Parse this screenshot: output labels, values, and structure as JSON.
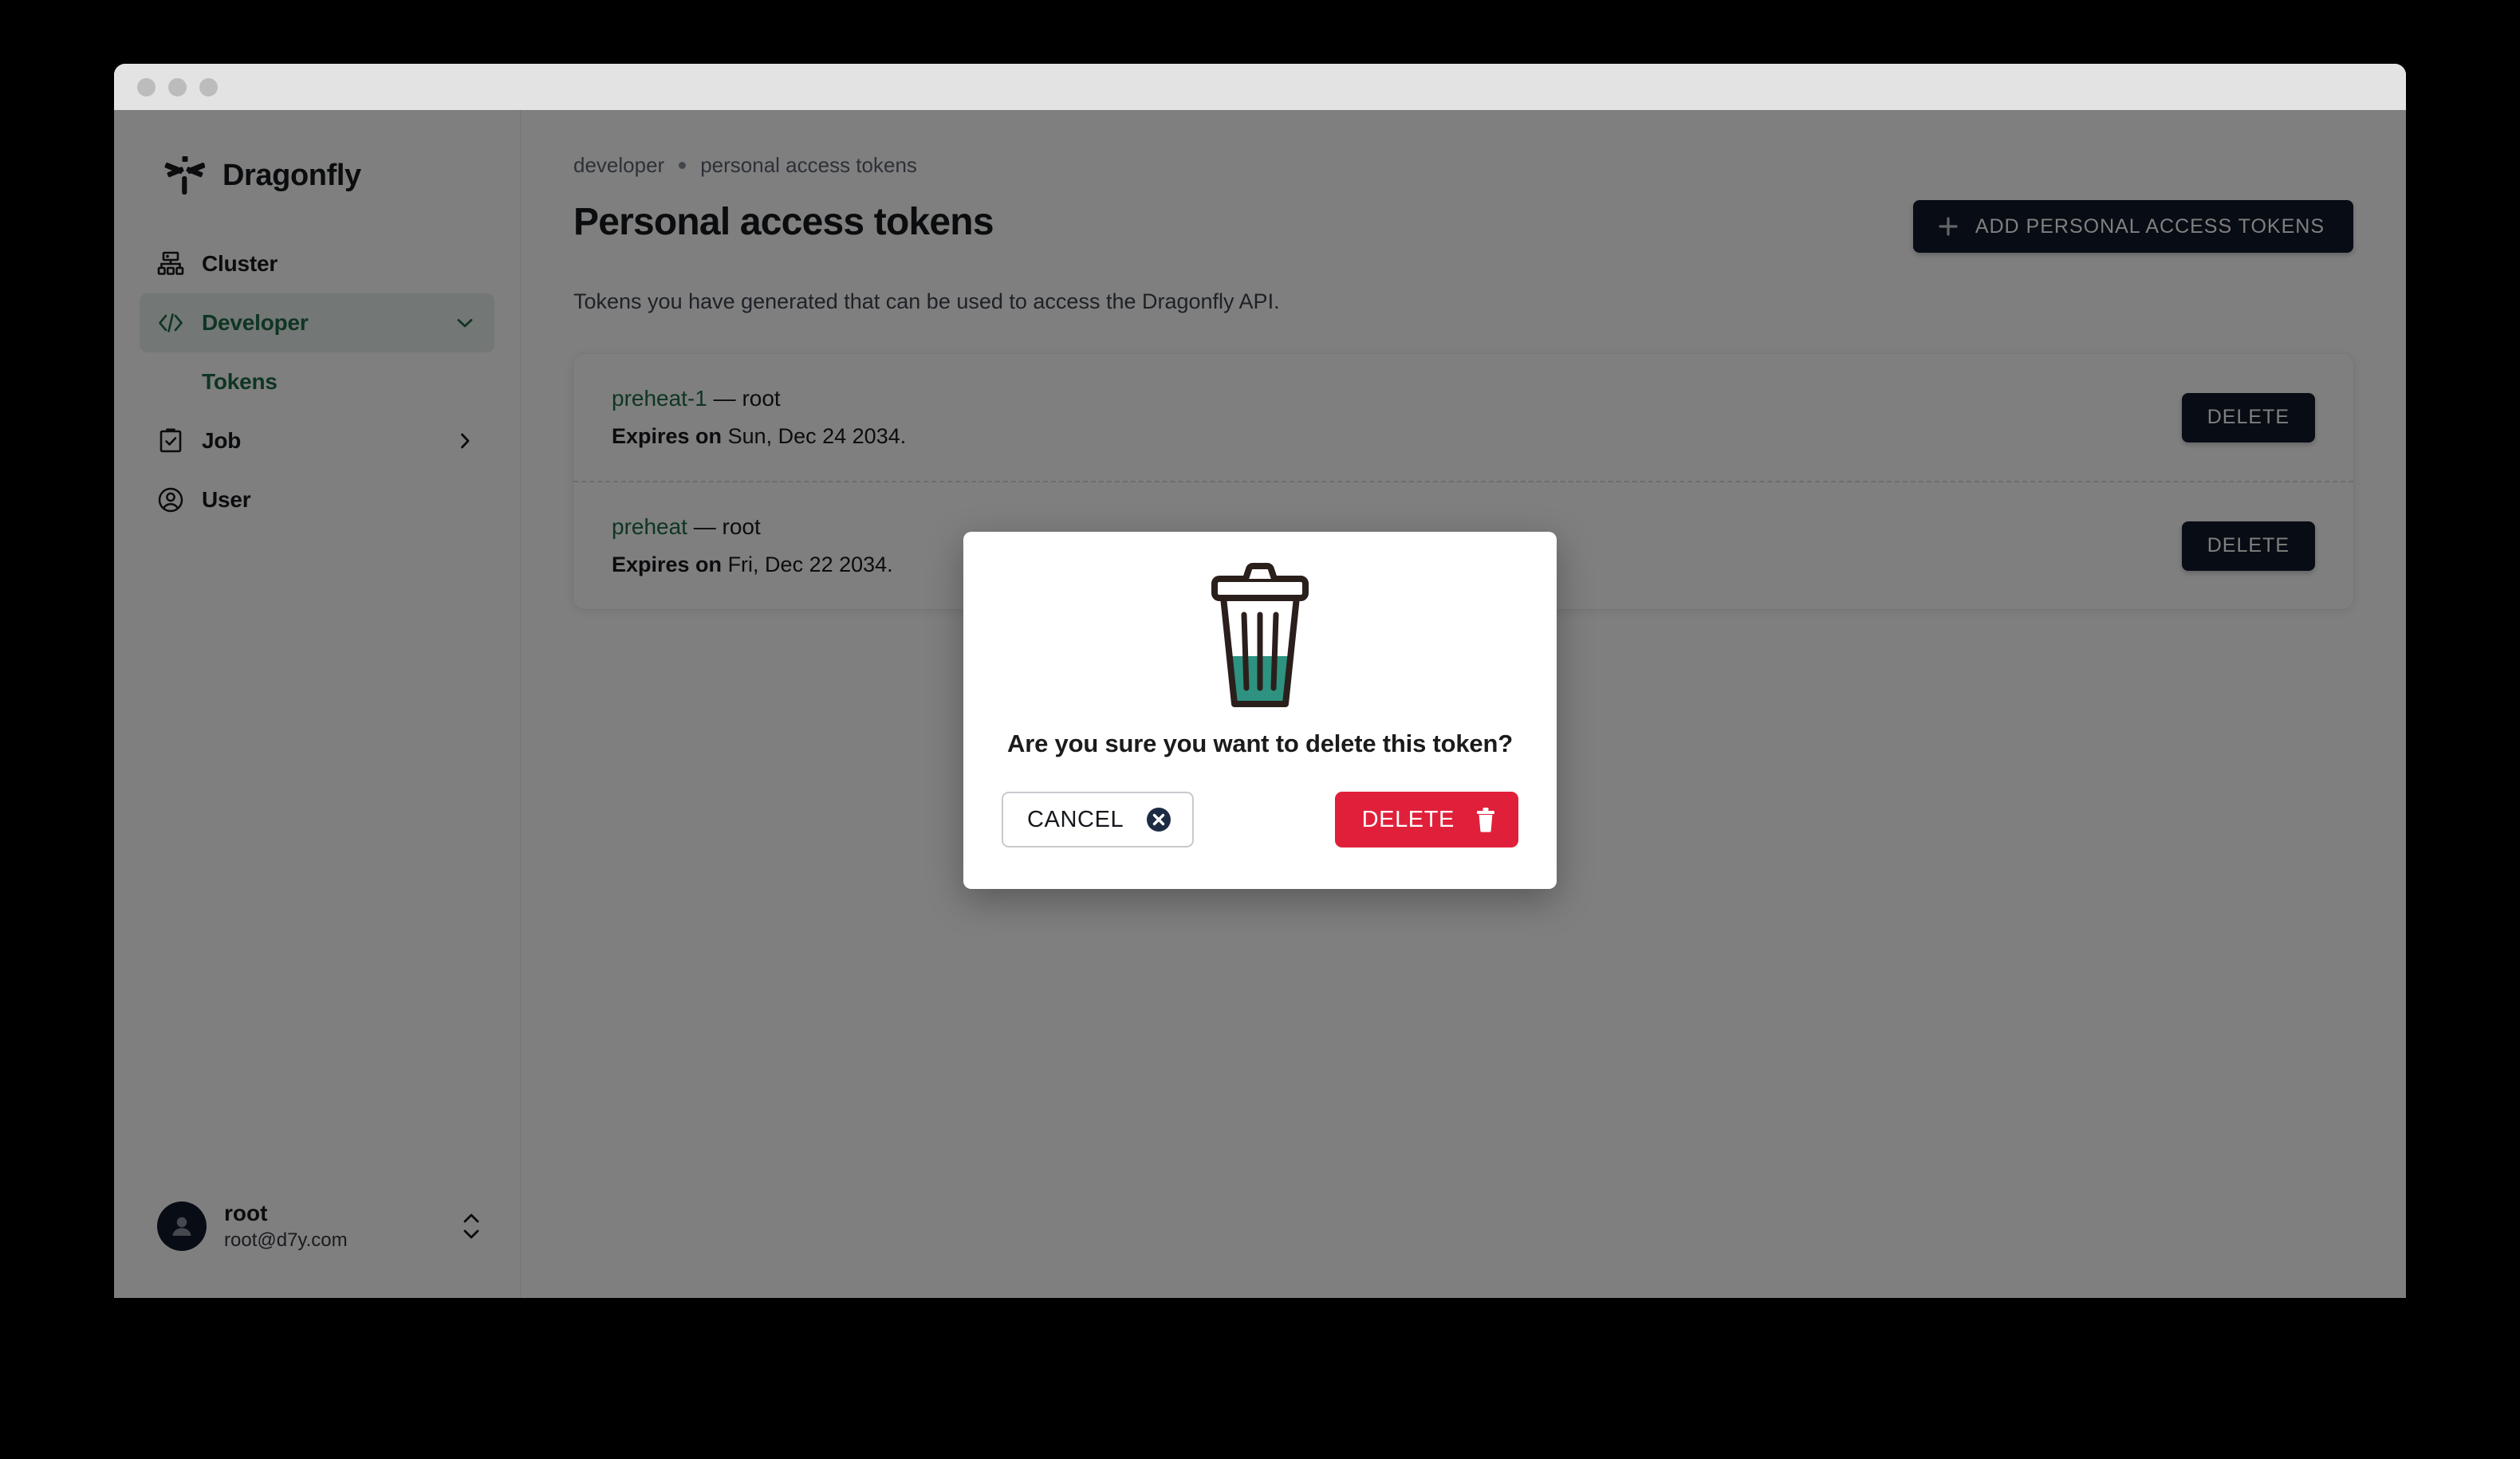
{
  "window": {
    "traffic_lights": [
      "close",
      "minimize",
      "zoom"
    ]
  },
  "sidebar": {
    "brand": {
      "name": "Dragonfly",
      "logo_icon": "dragonfly-logo-icon"
    },
    "items": [
      {
        "label": "Cluster",
        "icon": "cluster-icon",
        "state": "default",
        "chevron": ""
      },
      {
        "label": "Developer",
        "icon": "code-brackets-icon",
        "state": "active",
        "chevron": "chevron-down-icon"
      },
      {
        "label": "Tokens",
        "icon": "",
        "state": "sub-active",
        "chevron": ""
      },
      {
        "label": "Job",
        "icon": "clipboard-check-icon",
        "state": "default",
        "chevron": "chevron-right-icon"
      },
      {
        "label": "User",
        "icon": "user-circle-icon",
        "state": "default",
        "chevron": ""
      }
    ],
    "profile": {
      "name": "root",
      "email": "root@d7y.com",
      "avatar_icon": "avatar-icon",
      "switcher_icon": "chevron-up-down-icon"
    }
  },
  "main": {
    "breadcrumb": [
      "developer",
      "personal access tokens"
    ],
    "page_title": "Personal access tokens",
    "add_button": {
      "label": "ADD PERSONAL ACCESS TOKENS",
      "icon": "plus-icon"
    },
    "description": "Tokens you have generated that can be used to access the Dragonfly API.",
    "tokens": [
      {
        "name": "preheat-1",
        "dash": "—",
        "owner": "root",
        "expires_label": "Expires on",
        "expires_value": "Sun, Dec 24 2034.",
        "delete_label": "DELETE"
      },
      {
        "name": "preheat",
        "dash": "—",
        "owner": "root",
        "expires_label": "Expires on",
        "expires_value": "Fri, Dec 22 2034.",
        "delete_label": "DELETE"
      }
    ]
  },
  "modal": {
    "illustration_icon": "trash-can-illustration-icon",
    "title": "Are you sure you want to delete this token?",
    "cancel": {
      "label": "CANCEL",
      "icon": "circle-x-icon"
    },
    "confirm": {
      "label": "DELETE",
      "icon": "trash-icon"
    }
  },
  "colors": {
    "accent_green": "#1e6b47",
    "accent_green_bg": "#e7efea",
    "dark": "#101828",
    "danger_red": "#e0203a",
    "illustration_teal": "#2e9280"
  }
}
